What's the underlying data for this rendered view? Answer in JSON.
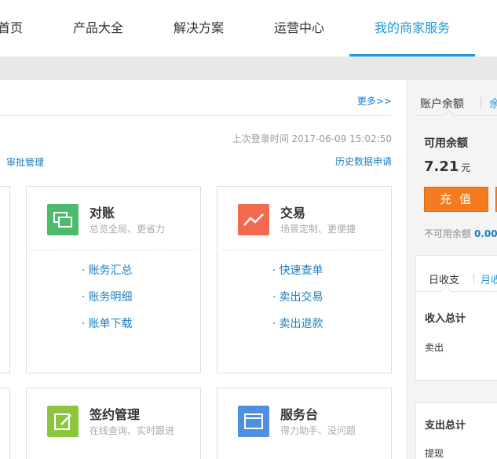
{
  "nav": {
    "items": [
      "首页",
      "产品大全",
      "解决方案",
      "运营中心",
      "我的商家服务"
    ],
    "active_index": 4
  },
  "main": {
    "more_link": "更多>>",
    "last_login": "上次登录时间 2017-06-09 15:02:50",
    "approval_link": "审批管理",
    "history_link": "历史数据申请",
    "cards": [
      {
        "title": "对账",
        "subtitle": "总览全局、更省力",
        "icon": "reconcile-icon",
        "color": "#4cbb6c",
        "links": [
          "账务汇总",
          "账务明细",
          "账单下载"
        ]
      },
      {
        "title": "交易",
        "subtitle": "场景定制、更便捷",
        "icon": "trend-chart-icon",
        "color": "#f2694e",
        "links": [
          "快速查单",
          "卖出交易",
          "卖出退款"
        ]
      },
      {
        "title": "签约管理",
        "subtitle": "在线查询、实时跟进",
        "icon": "sign-edit-icon",
        "color": "#8cc63f",
        "links": []
      },
      {
        "title": "服务台",
        "subtitle": "得力助手、没问题",
        "icon": "service-window-icon",
        "color": "#4d8fe0",
        "links": []
      }
    ]
  },
  "sidebar": {
    "tab_active": "账户余额",
    "tab_partial": "余",
    "available_label": "可用余额",
    "available_amount": "7.21",
    "currency_unit": "元",
    "recharge_button": "充值",
    "unavailable_label": "不可用余额",
    "unavailable_amount": "0.00",
    "box": {
      "tab_daily": "日收支",
      "tab_monthly": "月收支",
      "income_title": "收入总计",
      "income_item": "卖出",
      "expense_title": "支出总计",
      "expense_item": "提现"
    }
  }
}
